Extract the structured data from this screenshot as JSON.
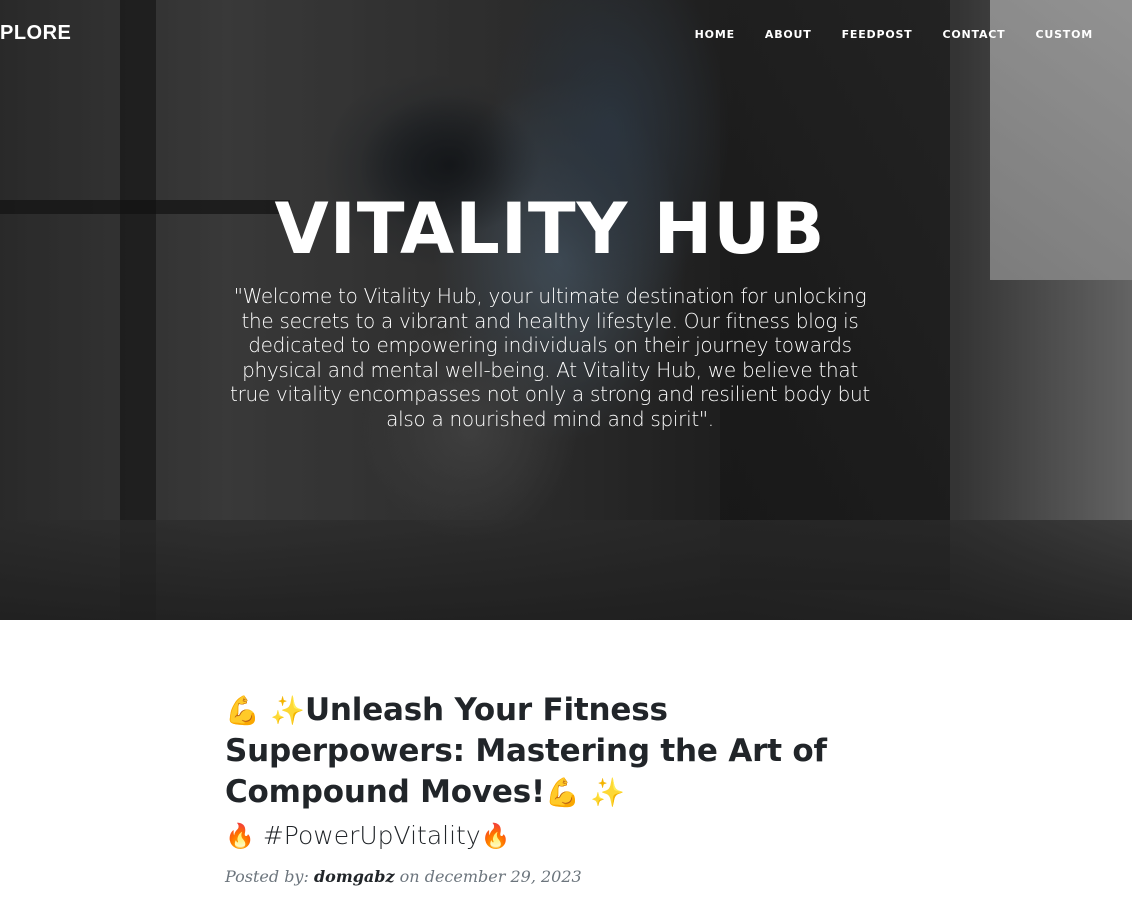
{
  "nav": {
    "brand": "PLORE",
    "links": [
      "HOME",
      "ABOUT",
      "FEEDPOST",
      "CONTACT",
      "CUSTOM"
    ]
  },
  "hero": {
    "title": "VITALITY HUB",
    "subtitle": "\"Welcome to Vitality Hub, your ultimate destination for unlocking the secrets to a vibrant and healthy lifestyle. Our fitness blog is dedicated to empowering individuals on their journey towards physical and mental well-being. At Vitality Hub, we believe that true vitality encompasses not only a strong and resilient body but also a nourished mind and spirit\"."
  },
  "post": {
    "title_prefix_icons": [
      "flexed-biceps",
      "sparkles"
    ],
    "title": "Unleash Your Fitness Superpowers: Mastering the Art of Compound Moves!",
    "title_suffix_icons": [
      "flexed-biceps",
      "sparkles"
    ],
    "subtitle_icon": "fire",
    "subtitle": "#PowerUpVitality",
    "meta_prefix": "Posted by:",
    "author": "domgabz",
    "meta_on": "on",
    "date": "december 29, 2023"
  },
  "colors": {
    "text_dark": "#212529",
    "meta_gray": "#6c757d",
    "hero_text": "#ffffff"
  }
}
